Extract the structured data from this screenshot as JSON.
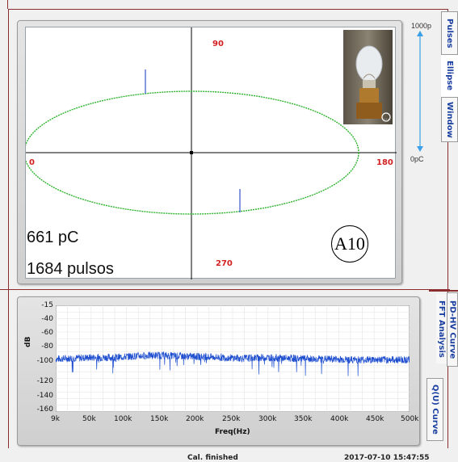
{
  "ellipse": {
    "angle_top": "90",
    "angle_left": "0",
    "angle_right": "180",
    "angle_bottom": "270",
    "charge": "661 pC",
    "pulses": "1684 pulsos",
    "badge": "A10",
    "scale_max": "1000p",
    "scale_min": "0pC",
    "colors": {
      "ellipse": "#2fb32f",
      "pulse": "#3355cc",
      "scale_arrow": "#3aa0e8",
      "angle_text": "#d42020"
    }
  },
  "tabs": {
    "top": [
      "Pulses",
      "Ellipse",
      "Window"
    ],
    "bottom": [
      "PD-HV Curve",
      "FFT Analysis",
      "Q(U) Curve"
    ],
    "active_top": "Ellipse",
    "active_bottom": "FFT Analysis"
  },
  "fft": {
    "y_ticks": [
      "-15",
      "-40",
      "-60",
      "-80",
      "-100",
      "-120",
      "-140",
      "-160"
    ],
    "x_ticks": [
      "9k",
      "50k",
      "100k",
      "150k",
      "200k",
      "250k",
      "300k",
      "350k",
      "400k",
      "450k",
      "500k"
    ],
    "x_label": "Freq(Hz)",
    "y_label": "dB",
    "trace_color": "#1f4fd0"
  },
  "chart_data": {
    "type": "line",
    "title": "",
    "xlabel": "Freq(Hz)",
    "ylabel": "dB",
    "xlim": [
      9000,
      500000
    ],
    "ylim": [
      -160,
      -15
    ],
    "grid": true,
    "series": [
      {
        "x": [
          9000,
          30000,
          60000,
          90000,
          120000,
          150000,
          180000,
          210000,
          240000,
          270000,
          300000,
          330000,
          360000,
          390000,
          420000,
          450000,
          480000,
          500000
        ],
        "values": [
          -88,
          -87,
          -86,
          -86,
          -84,
          -83,
          -84,
          -85,
          -86,
          -87,
          -86,
          -87,
          -88,
          -88,
          -89,
          -89,
          -89,
          -89
        ]
      }
    ]
  },
  "status": {
    "center": "Cal. finished",
    "right": "2017-07-10  15:47:55"
  }
}
